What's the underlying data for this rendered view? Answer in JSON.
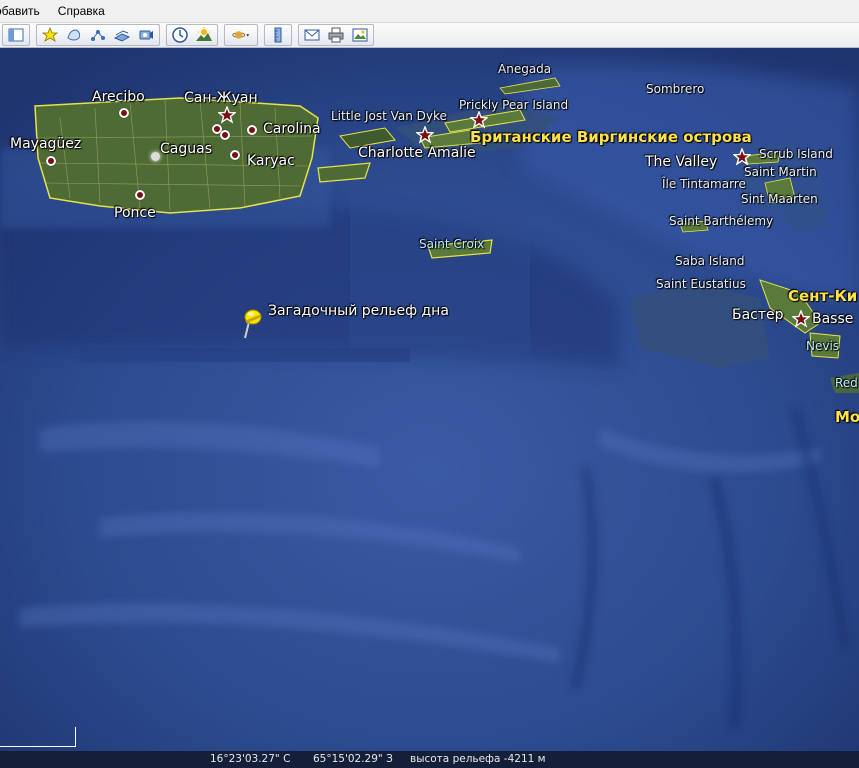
{
  "menu": {
    "items": [
      "обавить",
      "Справка"
    ]
  },
  "toolbar": {
    "icons": [
      "sidebar-toggle-icon",
      "placemark-add-icon",
      "polygon-add-icon",
      "path-add-icon",
      "image-overlay-add-icon",
      "tour-record-icon",
      "historical-imagery-icon",
      "sunlight-icon",
      "planet-switch-icon",
      "ruler-icon",
      "email-icon",
      "print-icon",
      "save-image-icon"
    ]
  },
  "map": {
    "places": {
      "arecibo": "Arecibo",
      "san_juan": "Сан-Жуан",
      "carolina": "Carolina",
      "mayaguez": "Mayagüez",
      "caguas": "Caguas",
      "karyak": "Karyac",
      "ponce": "Ponce",
      "little_jost": "Little Jost Van Dyke",
      "charlotte": "Charlotte Amalie",
      "prickly": "Prickly Pear Island",
      "anegada": "Anegada",
      "bvi": "Британские Виргинские острова",
      "sombrero": "Sombrero",
      "the_valley": "The Valley",
      "scrub": "Scrub Island",
      "tintamarre": "Île Tintamarre",
      "saint_martin": "Saint Martin",
      "sint_maarten": "Sint Maarten",
      "st_barth": "Saint Barthélemy",
      "saint_croix": "Saint Croix",
      "saba": "Saba Island",
      "st_eustatius": "Saint Eustatius",
      "st_kitts": "Сент-Ки",
      "baster": "Бастер",
      "basse": "Basse",
      "nevis": "Nevis",
      "redonda": "Red",
      "montserrat": "Мо"
    },
    "placemark": "Загадочный рельеф дна"
  },
  "status": {
    "lat": "16°23'03.27\"  С",
    "lon": "65°15'02.29\"  З",
    "elev": "высота рельефа -4211 м"
  },
  "colors": {
    "ocean": "#2f4d92",
    "land": "#4f6b35",
    "border": "#e6e24a",
    "country_label": "#ffe24a",
    "city_dot": "#7a0f12",
    "pin": "#ffe600"
  }
}
